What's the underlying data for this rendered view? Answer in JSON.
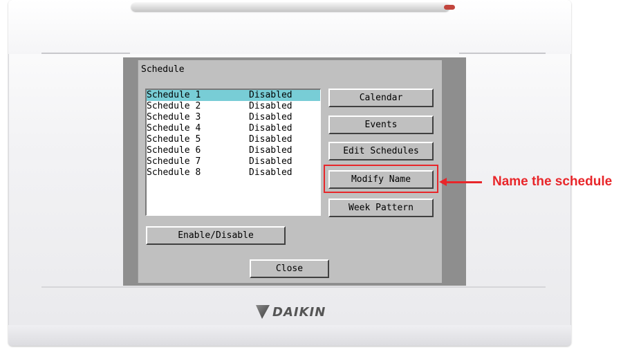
{
  "dialog": {
    "title": "Schedule",
    "schedules": [
      {
        "name": "Schedule 1",
        "status": "Disabled",
        "selected": true
      },
      {
        "name": "Schedule 2",
        "status": "Disabled",
        "selected": false
      },
      {
        "name": "Schedule 3",
        "status": "Disabled",
        "selected": false
      },
      {
        "name": "Schedule 4",
        "status": "Disabled",
        "selected": false
      },
      {
        "name": "Schedule 5",
        "status": "Disabled",
        "selected": false
      },
      {
        "name": "Schedule 6",
        "status": "Disabled",
        "selected": false
      },
      {
        "name": "Schedule 7",
        "status": "Disabled",
        "selected": false
      },
      {
        "name": "Schedule 8",
        "status": "Disabled",
        "selected": false
      }
    ],
    "buttons": {
      "calendar": "Calendar",
      "events": "Events",
      "edit_schedules": "Edit Schedules",
      "modify_name": "Modify Name",
      "week_pattern": "Week Pattern",
      "enable_disable": "Enable/Disable",
      "close": "Close"
    }
  },
  "device": {
    "brand": "DAIKIN"
  },
  "annotation": {
    "text": "Name the schedule",
    "color": "#e8262a"
  },
  "colors": {
    "selection": "#78cdd6",
    "dialog_bg": "#c0c0c0"
  }
}
